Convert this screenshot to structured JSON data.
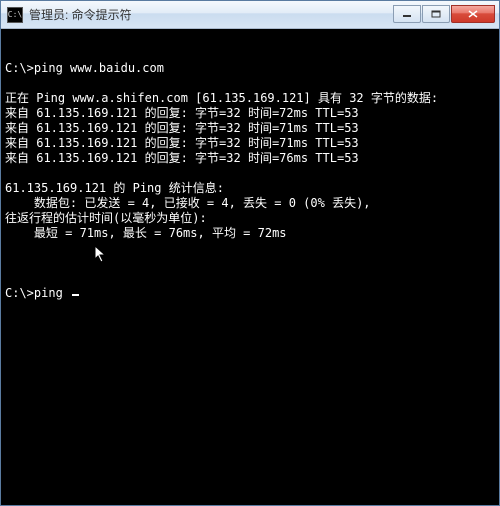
{
  "window": {
    "icon_text": "C:\\",
    "title": "管理员: 命令提示符"
  },
  "terminal": {
    "lines": [
      "C:\\>ping www.baidu.com",
      "",
      "正在 Ping www.a.shifen.com [61.135.169.121] 具有 32 字节的数据:",
      "来自 61.135.169.121 的回复: 字节=32 时间=72ms TTL=53",
      "来自 61.135.169.121 的回复: 字节=32 时间=71ms TTL=53",
      "来自 61.135.169.121 的回复: 字节=32 时间=71ms TTL=53",
      "来自 61.135.169.121 的回复: 字节=32 时间=76ms TTL=53",
      "",
      "61.135.169.121 的 Ping 统计信息:",
      "    数据包: 已发送 = 4, 已接收 = 4, 丢失 = 0 (0% 丢失),",
      "往返行程的估计时间(以毫秒为单位):",
      "    最短 = 71ms, 最长 = 76ms, 平均 = 72ms",
      ""
    ],
    "prompt": "C:\\>ping "
  }
}
